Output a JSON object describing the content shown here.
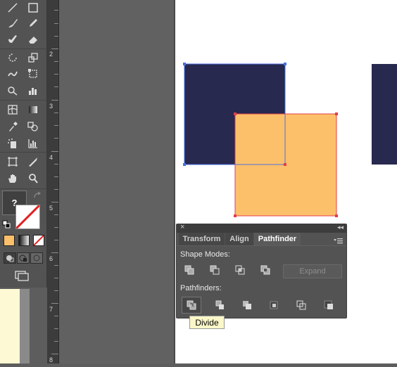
{
  "ruler": {
    "marks": [
      "2",
      "3",
      "4",
      "5",
      "6",
      "7",
      "8"
    ]
  },
  "panel": {
    "tabs": [
      {
        "label": "Transform"
      },
      {
        "label": "Align"
      },
      {
        "label": "Pathfinder"
      }
    ],
    "shape_modes_label": "Shape Modes:",
    "pathfinders_label": "Pathfinders:",
    "expand_label": "Expand"
  },
  "tooltip": {
    "text": "Divide"
  },
  "tools": {
    "unknown_fill_label": "?"
  },
  "colors": {
    "navy": "#27294f",
    "orange": "#fdc06a",
    "selection_blue": "#4a6fdc",
    "selection_red": "#e0404a"
  }
}
